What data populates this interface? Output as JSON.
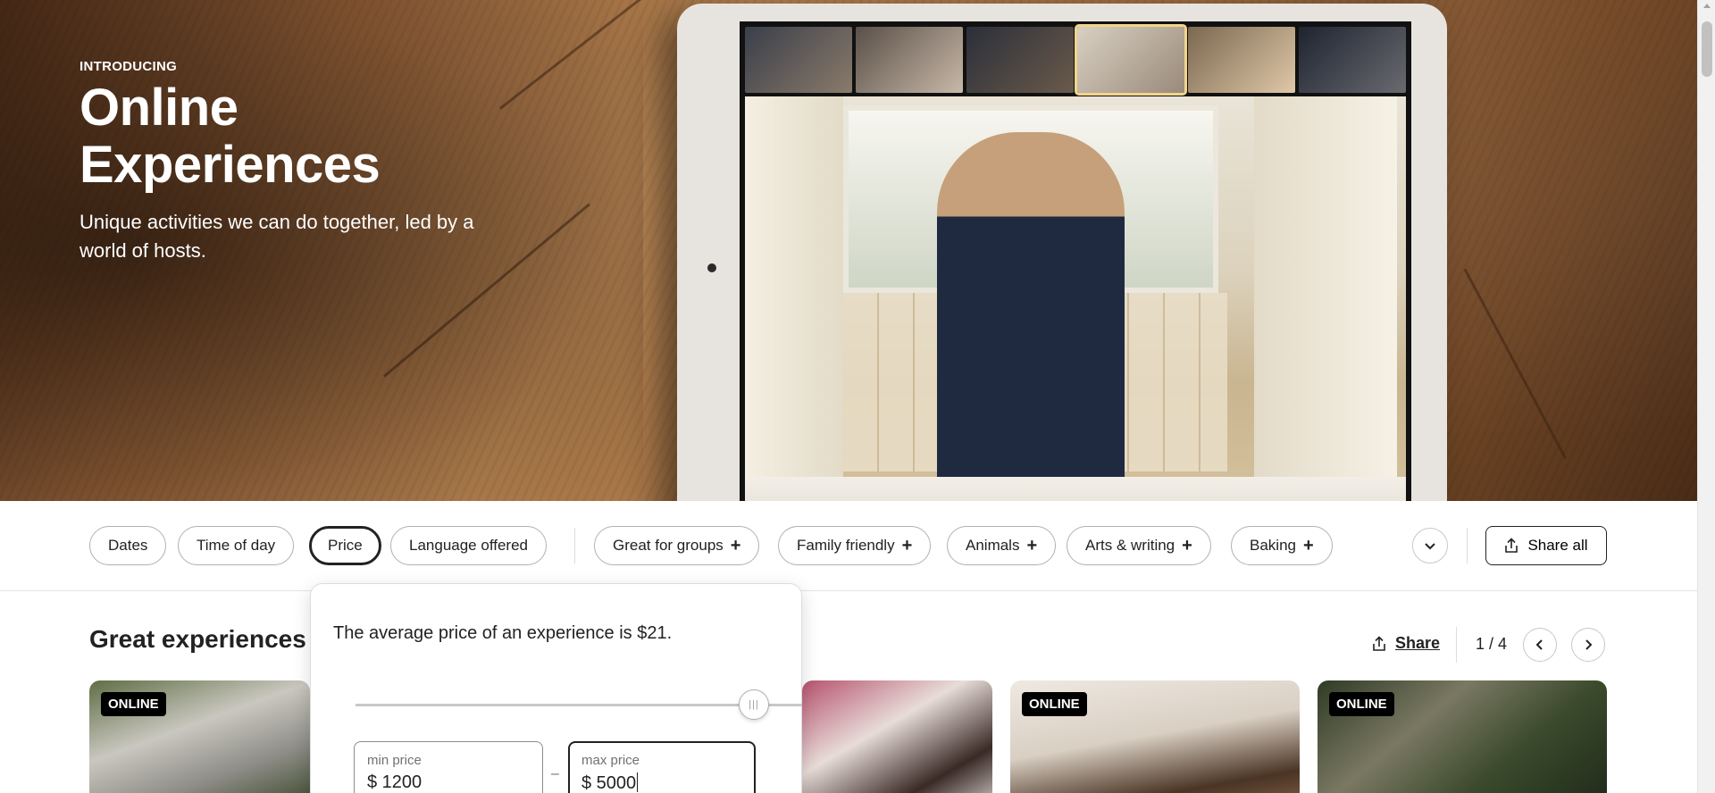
{
  "hero": {
    "eyebrow": "INTRODUCING",
    "title_line1": "Online",
    "title_line2": "Experiences",
    "subtitle": "Unique activities we can do together, led by a world of hosts."
  },
  "filters": {
    "chips": [
      "Dates",
      "Time of day",
      "Price",
      "Language offered"
    ],
    "selected": "Price",
    "category_chips": [
      "Great for groups",
      "Family friendly",
      "Animals",
      "Arts & writing",
      "Baking"
    ],
    "share_all_label": "Share all"
  },
  "section": {
    "title": "Great experiences t",
    "share_label": "Share",
    "pager": "1 / 4"
  },
  "cards": [
    {
      "badge": "ONLINE"
    },
    {
      "badge": "ONLINE"
    },
    {
      "badge": "ONLINE"
    }
  ],
  "price_popover": {
    "average_text": "The average price of an experience is $21.",
    "min_label": "min price",
    "min_value": "$  1200",
    "max_label": "max price",
    "max_value": "$  5000"
  },
  "colors": {
    "text": "#222222",
    "badge_bg": "#000000",
    "border": "#b0b0b0"
  }
}
